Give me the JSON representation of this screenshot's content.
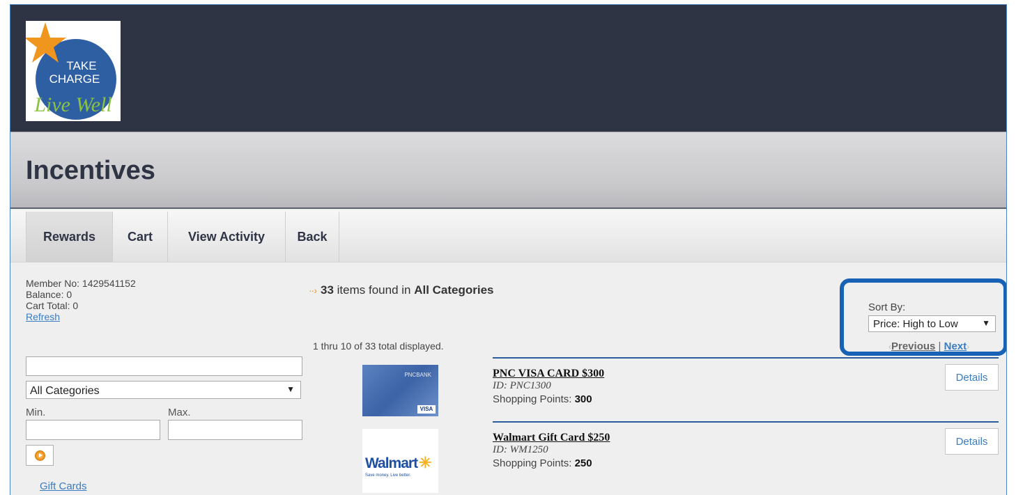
{
  "logo": {
    "line1": "TAKE",
    "line2": "CHARGE",
    "line3": "Live Well"
  },
  "page": {
    "title": "Incentives"
  },
  "tabs": [
    {
      "label": "Rewards"
    },
    {
      "label": "Cart"
    },
    {
      "label": "View Activity"
    },
    {
      "label": "Back"
    }
  ],
  "member": {
    "number": "Member No: 1429541152",
    "balance": "Balance: 0",
    "cart_total": "Cart Total: 0",
    "refresh": "Refresh"
  },
  "filters": {
    "search_value": "",
    "category": "All Categories",
    "min_label": "Min.",
    "max_label": "Max.",
    "min_value": "",
    "max_value": "",
    "gift_cards_link": "Gift Cards"
  },
  "results": {
    "count": "33",
    "found_text": " items found in ",
    "category": "All Categories",
    "displayed": "1 thru 10 of 33 total displayed."
  },
  "sort": {
    "label": "Sort By:",
    "selected": "Price: High to Low",
    "previous": "Previous",
    "separator": "|",
    "next": "Next"
  },
  "products": [
    {
      "name": "PNC VISA CARD $300",
      "id": "ID: PNC1300",
      "points_label": "Shopping Points: ",
      "points": "300",
      "details": "Details",
      "image_bank": "PNCBANK",
      "image_brand": "VISA"
    },
    {
      "name": "Walmart Gift Card $250",
      "id": "ID: WM1250",
      "points_label": "Shopping Points: ",
      "points": "250",
      "details": "Details",
      "image_brand": "Walmart",
      "image_tagline": "Save money. Live better."
    }
  ],
  "colors": {
    "header": "#2e3444",
    "link": "#3a7cc2",
    "highlight": "#1762b4",
    "accent_orange": "#f0961e"
  }
}
